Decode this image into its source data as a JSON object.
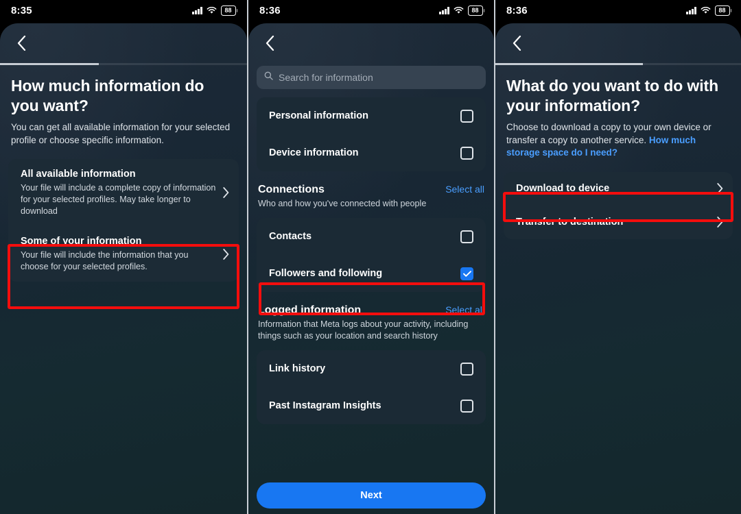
{
  "panels": [
    {
      "status": {
        "time": "8:35",
        "battery": "88",
        "signal_icon": "cellular-signal-icon",
        "wifi_icon": "wifi-icon",
        "battery_icon": "battery-icon"
      },
      "nav": {
        "back_icon": "chevron-left-icon",
        "progress_percent": 40
      },
      "title": "How much information do you want?",
      "subtitle": "You can get all available information for your selected profile or choose specific information.",
      "options": [
        {
          "title": "All available information",
          "desc": "Your file will include a complete copy of information for your selected profiles. May take longer to download",
          "chevron_icon": "chevron-right-icon",
          "highlighted": false
        },
        {
          "title": "Some of your information",
          "desc": "Your file will include the information that you choose for your selected profiles.",
          "chevron_icon": "chevron-right-icon",
          "highlighted": true
        }
      ]
    },
    {
      "status": {
        "time": "8:36",
        "battery": "88",
        "signal_icon": "cellular-signal-icon",
        "wifi_icon": "wifi-icon",
        "battery_icon": "battery-icon"
      },
      "nav": {
        "back_icon": "chevron-left-icon"
      },
      "search": {
        "placeholder": "Search for information",
        "value": "",
        "icon": "search-icon"
      },
      "top_items": [
        {
          "label": "Personal information",
          "checked": false
        },
        {
          "label": "Device information",
          "checked": false
        }
      ],
      "sections": [
        {
          "title": "Connections",
          "action": "Select all",
          "desc": "Who and how you've connected with people",
          "items": [
            {
              "label": "Contacts",
              "checked": false,
              "highlighted": false
            },
            {
              "label": "Followers and following",
              "checked": true,
              "highlighted": true
            }
          ]
        },
        {
          "title": "Logged information",
          "action": "Select all",
          "desc": "Information that Meta logs about your activity, including things such as your location and search history",
          "items": [
            {
              "label": "Link history",
              "checked": false,
              "highlighted": false
            },
            {
              "label": "Past Instagram Insights",
              "checked": false,
              "highlighted": false
            }
          ]
        }
      ],
      "primary_button": "Next"
    },
    {
      "status": {
        "time": "8:36",
        "battery": "88",
        "signal_icon": "cellular-signal-icon",
        "wifi_icon": "wifi-icon",
        "battery_icon": "battery-icon"
      },
      "nav": {
        "back_icon": "chevron-left-icon",
        "progress_percent": 60
      },
      "title": "What do you want to do with your information?",
      "subtitle_text": "Choose to download a copy to your own device or transfer a copy to another service. ",
      "subtitle_link": "How much storage space do I need?",
      "options": [
        {
          "title": "Download to device",
          "chevron_icon": "chevron-right-icon",
          "highlighted": true
        },
        {
          "title": "Transfer to destination",
          "chevron_icon": "chevron-right-icon",
          "highlighted": false
        }
      ]
    }
  ],
  "colors": {
    "accent_blue": "#1877f2",
    "link_blue": "#4a9eff",
    "highlight_red": "#f40d0d",
    "card_bg": "#1c2b36",
    "screen_bg": "#182734"
  }
}
